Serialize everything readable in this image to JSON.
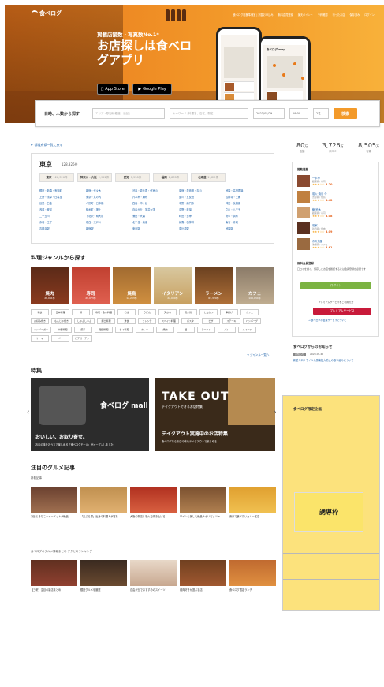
{
  "header": {
    "logo": "食べログ",
    "nav": [
      "食べログ店舗準備室 | 掲載お申込み",
      "無料会員登録",
      "楽天ポイント",
      "予約確認",
      "行ったお店",
      "保存済み",
      "ログイン"
    ]
  },
  "hero": {
    "subtitle": "掲載店舗数・写真数No.1*",
    "title": "お店探しは食べログアプリ",
    "app_store": "App Store",
    "google_play": "Google Play",
    "caption": "* 2021年10月調べ",
    "phone_title": "食べログ map"
  },
  "search": {
    "label": "日時、人数から探す",
    "area_placeholder": "エリア・駅 [例:銀座、渋谷]",
    "keyword_placeholder": "キーワード [料理名、店名、駅名]",
    "date": "2023/05/29",
    "time": "19:00",
    "people": "2名",
    "button": "検索"
  },
  "left": {
    "back_link": "← 都道府県一覧に戻る",
    "region": {
      "title": "東京",
      "count": "128,326件",
      "prefs": [
        {
          "name": "東京",
          "count": "128,326件"
        },
        {
          "name": "神奈川・大阪",
          "count": "2,922件"
        },
        {
          "name": "愛知",
          "count": "1,558件"
        },
        {
          "name": "福岡",
          "count": "2,878件"
        },
        {
          "name": "北海道",
          "count": "2,629件"
        }
      ],
      "areas": [
        "銀座・新橋・有楽町",
        "新宿・代々木",
        "渋谷・恵比寿・代官山",
        "原宿・表参道・青山",
        "池袋・高田馬場",
        "上野・浅草・日暮里",
        "東京・丸の内",
        "六本木・麻布",
        "品川・五反田",
        "吉祥寺・三鷹",
        "目黒・白金",
        "人形町・日本橋",
        "四谷・市ヶ谷",
        "中野・高円寺",
        "神田・秋葉原",
        "浅草・蔵前",
        "錦糸町・押上",
        "自由が丘・学芸大学",
        "中野・荻窪",
        "立川・八王子",
        "二子玉川",
        "下北沢・明大前",
        "蒲田・大森",
        "町田・多摩",
        "府中・調布",
        "赤羽・王子",
        "葛西・江戸川",
        "北千住・綾瀬",
        "練馬・石神井",
        "亀有・青砥",
        "吉祥寺駅",
        "新宿駅",
        "東京駅",
        "恵比寿駅",
        "池袋駅"
      ]
    },
    "genre_title": "料理ジャンルから探す",
    "genres": [
      {
        "name": "焼肉",
        "count": "28,041件"
      },
      {
        "name": "寿司",
        "count": "29,073件"
      },
      {
        "name": "焼鳥",
        "count": "12,203件"
      },
      {
        "name": "イタリアン",
        "count": "22,000件"
      },
      {
        "name": "ラーメン",
        "count": "61,329件"
      },
      {
        "name": "カフェ",
        "count": "100,034件"
      }
    ],
    "tags": [
      "和食",
      "日本料理",
      "鍋",
      "寿司・魚介料理",
      "そば",
      "うどん",
      "天ぷら",
      "焼き鳥",
      "とんかつ",
      "串揚げ",
      "カフェ",
      "お好み焼き",
      "もんじゃ焼き",
      "しゃぶしゃぶ",
      "郷土料理",
      "洋食",
      "フレンチ",
      "スペイン料理",
      "パスタ",
      "ピザ",
      "ステーキ",
      "ハンバーグ",
      "ハンバーガー",
      "中華料理",
      "餃子",
      "韓国料理",
      "タイ料理",
      "カレー",
      "焼肉",
      "麺",
      "ラーメン",
      "パン",
      "スイーツ",
      "ケーキ",
      "バー",
      "ビアガーデン"
    ],
    "more_link": "→ ジャンル一覧へ",
    "special_title": "特集",
    "promo1_big": "食べログ mall",
    "promo1_headline": "おいしい、お取り寄せ。",
    "promo1_text": "お店の味をおうちで楽しめる「食べログモール」がオープンしました",
    "promo2_big": "TAKE OUT",
    "promo2_sub": "テイクアウトできるお店特集",
    "promo2_headline": "テイクアウト実施中のお店特集",
    "promo2_text": "食べログならお店の味をテイクアウトで楽しめる",
    "articles_title": "注目のグルメ記事",
    "new_label": "新着記事",
    "articles1": [
      "冷麺ときなこシャーベットが絶品！",
      "「天ぷら屋」出身の料理人が営む",
      "大阪の新店！炭火で焼き上げる",
      "ワインと楽しむ絶品ナポリピッツァ",
      "東京で食べたいカレー名店"
    ],
    "ranking_label": "食べログのグルメ情報まとめ アクセスランキング",
    "articles2": [
      "【三軒】注目の新店まとめ",
      "銀座グルメを厳選",
      "自由が丘でおすすめのスイーツ",
      "焼肉好きが選ぶ名店",
      "食べログ限定ランチ"
    ]
  },
  "right": {
    "stats": [
      {
        "num": "80",
        "unit": "万",
        "label": "店舗"
      },
      {
        "num": "3,726",
        "unit": "万",
        "label": "口コミ"
      },
      {
        "num": "8,505",
        "unit": "万",
        "label": "写真"
      }
    ],
    "rank_title": "閲覧履歴",
    "ranking": [
      {
        "name": "一宇亭",
        "sub": "銀座駅 / 寿司",
        "score": "3.20"
      },
      {
        "name": "炭火 焼鳥 今",
        "sub": "渋谷駅 / 焼鳥",
        "score": "3.42"
      },
      {
        "name": "鮨 鈴木",
        "sub": "銀座駅 / 寿司",
        "score": "3.08"
      },
      {
        "name": "炭家",
        "sub": "新宿駅 / 焼肉",
        "score": "3.09"
      },
      {
        "name": "お天気屋",
        "sub": "池袋駅 / カフェ",
        "score": "3.61"
      }
    ],
    "member_title": "無料会員登録",
    "member_text": "口コミを書く、保存したお店を確認するには会員登録が必要です",
    "login_button": "ログイン",
    "premium_text": "プレミアムサービスをご利用の方",
    "premium_button": "プレミアムサービス",
    "premium_link": "→ 食べログの会員サービスについて",
    "news_title": "食べログからのお知らせ",
    "news_tag": "お知らせ",
    "news_date": "2020.05.20",
    "news_text": "新型コロナウイルス感染拡大防止の取り組みについて",
    "limited_title": "食べログ限定企画",
    "ad_label": "誘導枠"
  }
}
